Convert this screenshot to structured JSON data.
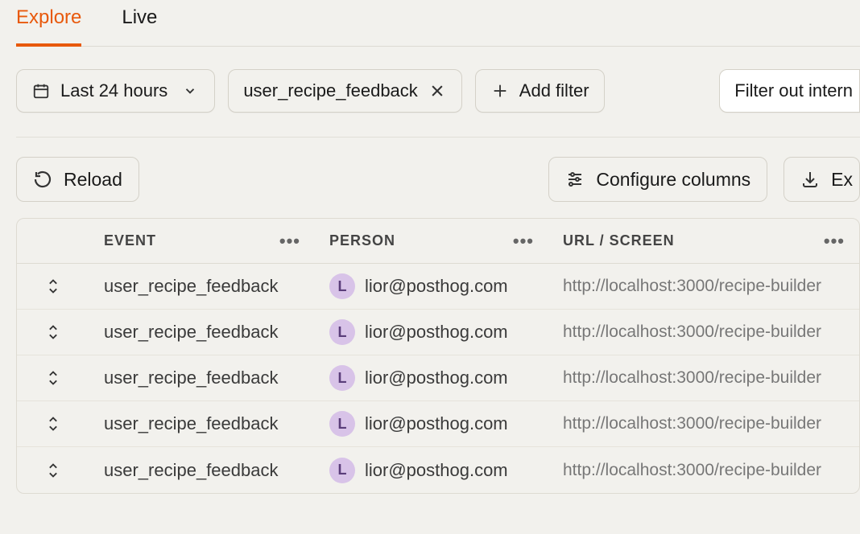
{
  "tabs": {
    "explore": "Explore",
    "live": "Live",
    "active": "explore"
  },
  "filters": {
    "date_label": "Last 24 hours",
    "event_filter": "user_recipe_feedback",
    "add_filter_label": "Add filter",
    "filter_out_label": "Filter out intern"
  },
  "actions": {
    "reload_label": "Reload",
    "configure_label": "Configure columns",
    "export_label": "Ex"
  },
  "table": {
    "columns": {
      "event": "EVENT",
      "person": "PERSON",
      "url": "URL / SCREEN"
    },
    "rows": [
      {
        "event": "user_recipe_feedback",
        "person_initial": "L",
        "person": "lior@posthog.com",
        "url": "http://localhost:3000/recipe-builder"
      },
      {
        "event": "user_recipe_feedback",
        "person_initial": "L",
        "person": "lior@posthog.com",
        "url": "http://localhost:3000/recipe-builder"
      },
      {
        "event": "user_recipe_feedback",
        "person_initial": "L",
        "person": "lior@posthog.com",
        "url": "http://localhost:3000/recipe-builder"
      },
      {
        "event": "user_recipe_feedback",
        "person_initial": "L",
        "person": "lior@posthog.com",
        "url": "http://localhost:3000/recipe-builder"
      },
      {
        "event": "user_recipe_feedback",
        "person_initial": "L",
        "person": "lior@posthog.com",
        "url": "http://localhost:3000/recipe-builder"
      }
    ]
  }
}
